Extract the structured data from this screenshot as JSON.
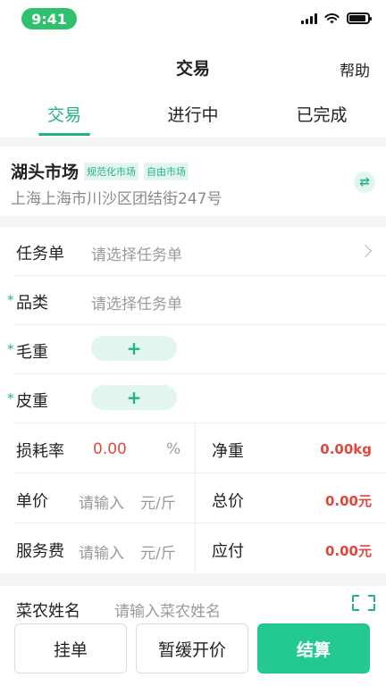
{
  "status": {
    "time": "9:41"
  },
  "nav": {
    "title": "交易",
    "help": "帮助"
  },
  "tabs": [
    {
      "label": "交易",
      "active": true
    },
    {
      "label": "进行中",
      "active": false
    },
    {
      "label": "已完成",
      "active": false
    }
  ],
  "market": {
    "name": "湖头市场",
    "tags": [
      "规范化市场",
      "自由市场"
    ],
    "address": "上海上海市川沙区团结街247号",
    "swap_icon": "⇄"
  },
  "form": {
    "task": {
      "label": "任务单",
      "placeholder": "请选择任务单"
    },
    "category": {
      "required_mark": "*",
      "label": "品类",
      "placeholder": "请选择任务单"
    },
    "gross_weight": {
      "required_mark": "*",
      "label": "毛重",
      "add": "+"
    },
    "tare_weight": {
      "required_mark": "*",
      "label": "皮重",
      "add": "+"
    },
    "loss_rate": {
      "label": "损耗率",
      "value": "0.00",
      "unit": "%"
    },
    "net_weight": {
      "label": "净重",
      "value": "0.00kg"
    },
    "unit_price": {
      "label": "单价",
      "placeholder": "请输入",
      "unit": "元/斤"
    },
    "total_price": {
      "label": "总价",
      "value": "0.00元"
    },
    "service_fee": {
      "label": "服务费",
      "placeholder": "请输入",
      "unit": "元/斤"
    },
    "payable": {
      "label": "应付",
      "value": "0.00元"
    }
  },
  "farmer": {
    "label": "菜农姓名",
    "placeholder": "请输入菜农姓名"
  },
  "bottom": {
    "hold": "挂单",
    "defer": "暂缓开价",
    "settle": "结算"
  },
  "colors": {
    "accent": "#23b383",
    "danger": "#e0483e",
    "status_pill": "#2fc16b"
  }
}
